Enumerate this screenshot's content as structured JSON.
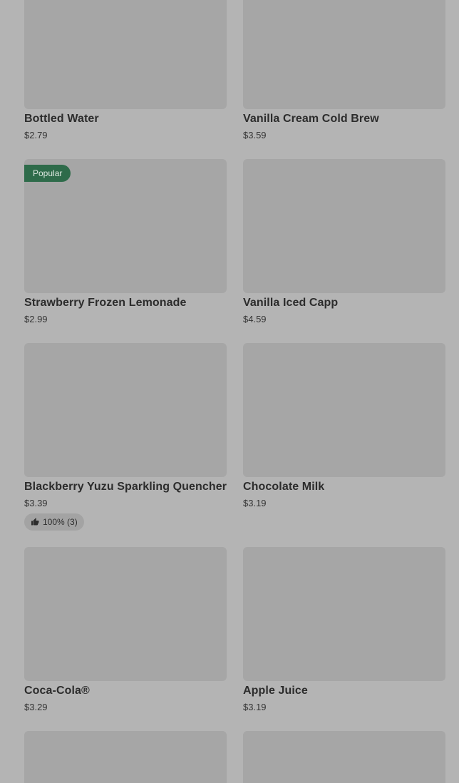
{
  "products": [
    {
      "name": "Bottled Water",
      "price": "$2.79"
    },
    {
      "name": "Vanilla Cream Cold Brew",
      "price": "$3.59"
    },
    {
      "name": "Strawberry Frozen Lemonade",
      "price": "$2.99",
      "badge": "Popular"
    },
    {
      "name": "Vanilla Iced Capp",
      "price": "$4.59"
    },
    {
      "name": "Blackberry Yuzu Sparkling Quencher",
      "price": "$3.39",
      "rating": "100% (3)"
    },
    {
      "name": "Chocolate Milk",
      "price": "$3.19"
    },
    {
      "name": "Coca-Cola®",
      "price": "$3.29"
    },
    {
      "name": "Apple Juice",
      "price": "$3.19"
    }
  ],
  "icons": {
    "rating": "thumbs-up-icon"
  }
}
